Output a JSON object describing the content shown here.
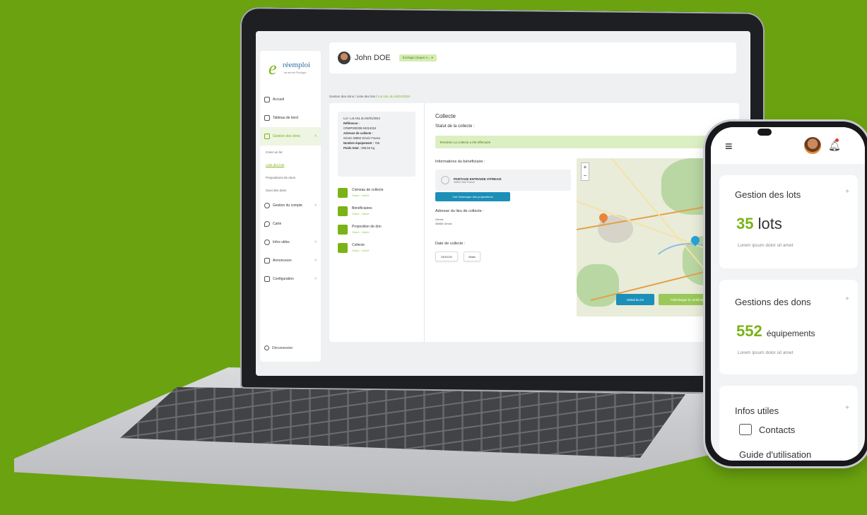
{
  "brand": {
    "logo_letter": "e",
    "logo_word": "réemploi",
    "logo_tag": "un service Ecologic",
    "accent": "#7ab317",
    "secondary": "#1b8fb8",
    "background": "#6aa30f"
  },
  "sidebar": {
    "items": [
      {
        "label": "Accueil",
        "icon": "home-icon"
      },
      {
        "label": "Tableau de bord",
        "icon": "dashboard-icon"
      },
      {
        "label": "Gestion des dons",
        "icon": "box-icon",
        "active": true
      },
      {
        "label": "Gestion du compte",
        "icon": "user-icon"
      },
      {
        "label": "Carte",
        "icon": "map-pin-icon"
      },
      {
        "label": "Infos utiles",
        "icon": "info-icon"
      },
      {
        "label": "Annonceurs",
        "icon": "megaphone-icon"
      },
      {
        "label": "Configuration",
        "icon": "settings-icon"
      }
    ],
    "sub_items": [
      "Créer un lot",
      "Liste des lots",
      "Propositions de dons",
      "Suivi des dons"
    ],
    "logout": "Déconnexion"
  },
  "header": {
    "user_name": "John DOE",
    "role": "Ecologic (Super A..."
  },
  "breadcrumb": {
    "items": [
      "Gestion des dons",
      "Liste des lots"
    ],
    "current": "Lot ASL du 04/01/2024"
  },
  "lot_info": {
    "title": "Lot : Lot ASL du 04/01/2024",
    "reference_label": "Référence :",
    "reference": "CRMP000008-04012024",
    "adresse_label": "Adresse de collecte :",
    "adresse": "Gévéz 35850 Gévéz France",
    "nombre_label": "Nombre équipement :",
    "nombre": "765",
    "poids_label": "Poids total :",
    "poids": "398,55 Kg"
  },
  "steps": [
    {
      "title": "Créneau de collecte",
      "status": "Statut : Validé",
      "icon": "calendar-icon"
    },
    {
      "title": "Bénéficiaires",
      "status": "Statut : Validé",
      "icon": "search-icon"
    },
    {
      "title": "Proposition de don",
      "status": "Statut : Validé",
      "icon": "gift-icon"
    },
    {
      "title": "Collecte",
      "status": "Statut : Validé",
      "icon": "truck-icon"
    }
  ],
  "collecte": {
    "title": "Collecte",
    "statut_label": "Statut de la collecte :",
    "statut_value": "Terminée   La collecte a été effectuée",
    "benef_label": "Informations du bénéficiaire :",
    "benef_name": "PARTAGE ENTRAIDE VITREAIS",
    "benef_addr": "35500 Vitré France",
    "history_button": "Voir l'historique des propositions",
    "adresse_label": "Adresse du lieu de collecte :",
    "adresse_line1": "Gévéz",
    "adresse_line2": "35850 Gévéz",
    "date_label": "Date de collecte :",
    "date_chip": "04/01/24",
    "period_chip": "Matin"
  },
  "actions": {
    "detail": "Détail du lot",
    "certificate": "Télécharger le certificat"
  },
  "phone": {
    "cards": [
      {
        "title": "Gestion des lots",
        "number": "35",
        "unit": "lots",
        "lorem": "Lorem ipsum dolor sit amet"
      },
      {
        "title": "Gestions des dons",
        "number": "552",
        "unit": "équipements",
        "lorem": "Lorem ipsum dolor sit amet"
      }
    ],
    "infos_title": "Infos utiles",
    "contacts": "Contacts",
    "guide": "Guide d'utilisation"
  }
}
